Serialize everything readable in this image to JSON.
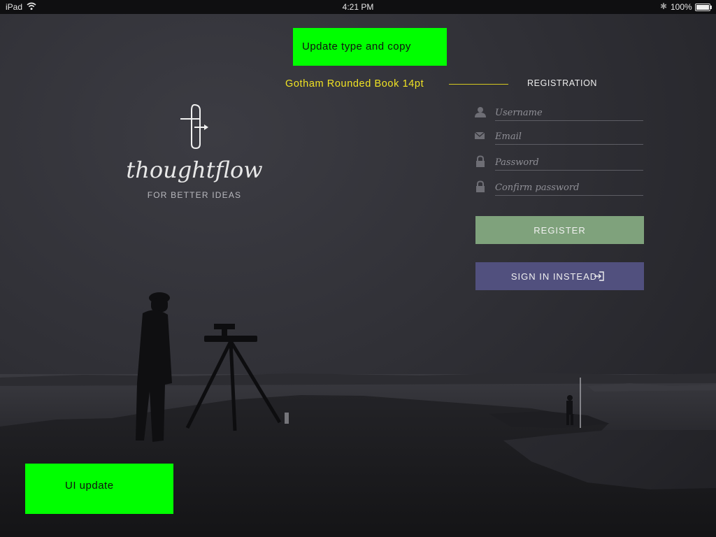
{
  "status_bar": {
    "device": "iPad",
    "time": "4:21 PM",
    "battery": "100%"
  },
  "brand": {
    "name": "thoughtflow",
    "tagline": "FOR BETTER IDEAS"
  },
  "annotations": {
    "top_note": "Update type and copy",
    "font_note": "Gotham Rounded Book 14pt",
    "bottom_note": "UI update"
  },
  "registration": {
    "title": "REGISTRATION",
    "fields": {
      "username_placeholder": "Username",
      "email_placeholder": "Email",
      "password_placeholder": "Password",
      "confirm_placeholder": "Confirm password"
    },
    "register_label": "REGISTER",
    "signin_label": "SIGN IN INSTEAD"
  },
  "icons": [
    "wifi-icon",
    "bluetooth-icon",
    "battery-icon",
    "thoughtflow-logo-icon",
    "user-icon",
    "mail-icon",
    "lock-icon",
    "sign-in-icon"
  ],
  "colors": {
    "register_button": "#7fa27c",
    "signin_button": "#51507e",
    "annotation_box": "#00ff00",
    "annotation_text": "#f1e323"
  }
}
